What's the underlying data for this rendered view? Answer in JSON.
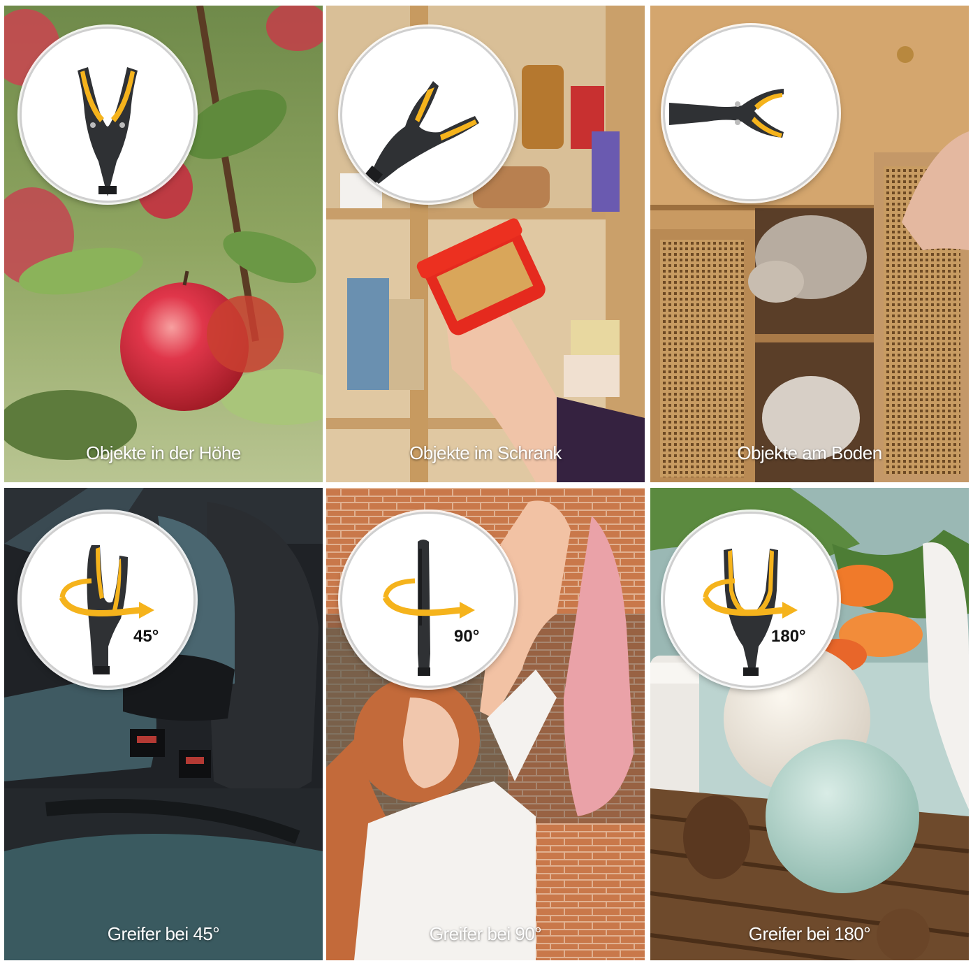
{
  "tiles": [
    {
      "caption": "Objekte in der Höhe"
    },
    {
      "caption": "Objekte im Schrank"
    },
    {
      "caption": "Objekte am Boden"
    },
    {
      "caption": "Greifer bei 45°",
      "angle": "45°"
    },
    {
      "caption": "Greifer bei 90°",
      "angle": "90°"
    },
    {
      "caption": "Greifer bei 180°",
      "angle": "180°"
    }
  ],
  "colors": {
    "accent_yellow": "#f5b31c",
    "tool_dark": "#2f3134"
  },
  "icons": [
    "grabber-claw-icon",
    "rotation-arrow-icon"
  ]
}
